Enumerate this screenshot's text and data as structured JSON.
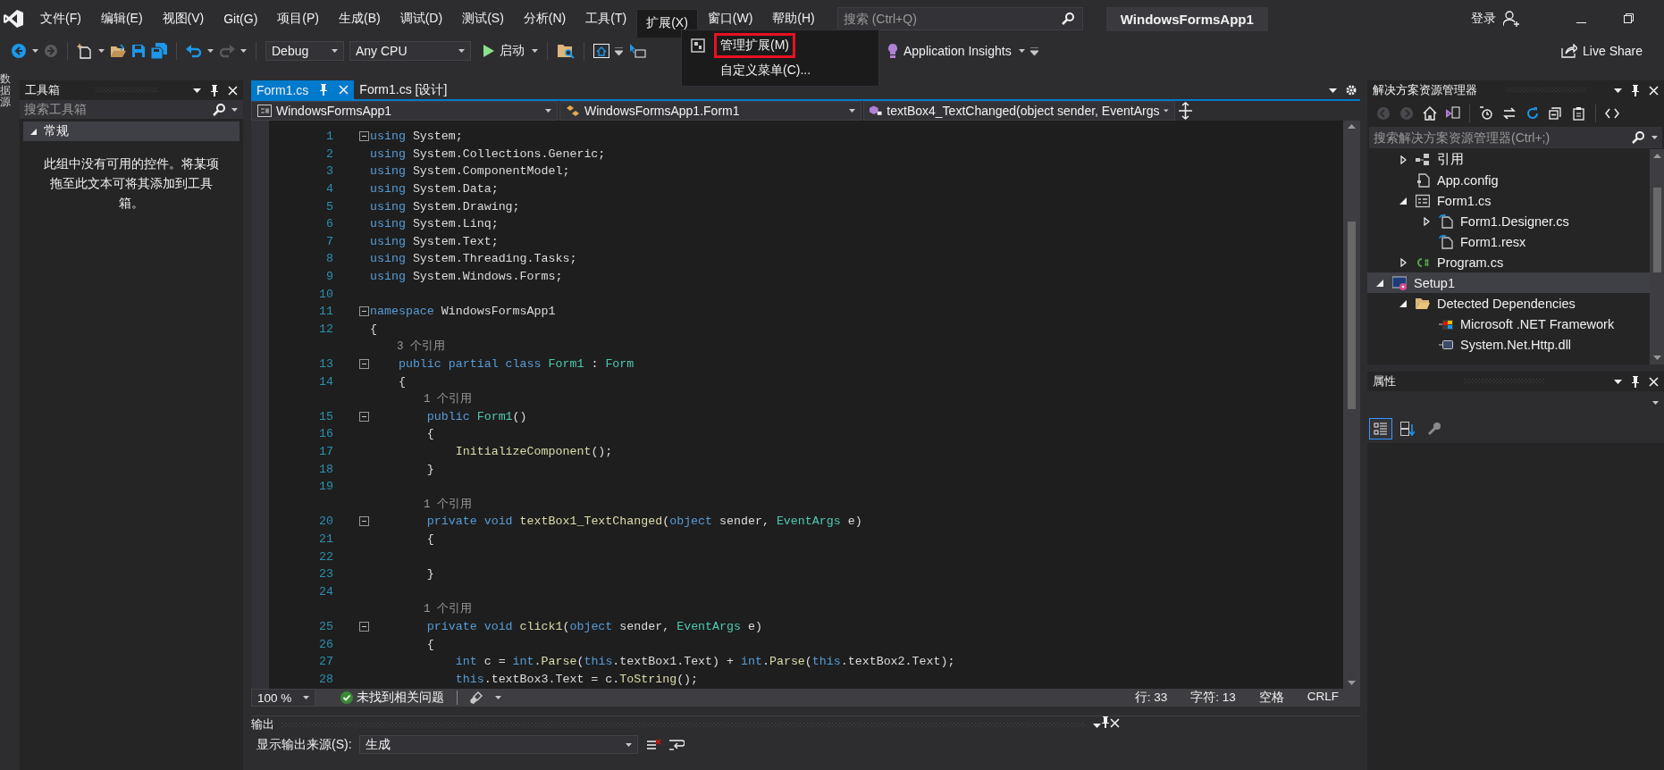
{
  "window": {
    "title": "WindowsFormsApp1",
    "side_tab": "数据源"
  },
  "menu": [
    {
      "label": "文件(F)",
      "selected": false
    },
    {
      "label": "编辑(E)",
      "selected": false
    },
    {
      "label": "视图(V)",
      "selected": false
    },
    {
      "label": "Git(G)",
      "selected": false
    },
    {
      "label": "项目(P)",
      "selected": false
    },
    {
      "label": "生成(B)",
      "selected": false
    },
    {
      "label": "调试(D)",
      "selected": false
    },
    {
      "label": "测试(S)",
      "selected": false
    },
    {
      "label": "分析(N)",
      "selected": false
    },
    {
      "label": "工具(T)",
      "selected": false
    },
    {
      "label": "扩展(X)",
      "selected": true
    },
    {
      "label": "窗口(W)",
      "selected": false
    },
    {
      "label": "帮助(H)",
      "selected": false
    }
  ],
  "dropdown": [
    {
      "label": "管理扩展(M)",
      "highlighted": true
    },
    {
      "label": "自定义菜单(C)...",
      "highlighted": false
    }
  ],
  "search": {
    "placeholder": "搜索 (Ctrl+Q)"
  },
  "account": {
    "label": "登录"
  },
  "toolbar": {
    "configuration": "Debug",
    "platform": "Any CPU",
    "start": "启动",
    "insights": "Application Insights",
    "live_share": "Live Share"
  },
  "toolbox": {
    "title": "工具箱",
    "search_placeholder": "搜索工具箱",
    "group": {
      "label": "常规",
      "expanded": true
    },
    "empty_message": "此组中没有可用的控件。将某项拖至此文本可将其添加到工具箱。"
  },
  "editor": {
    "tabs": [
      {
        "label": "Form1.cs",
        "selected": true
      },
      {
        "label": "Form1.cs [设计]",
        "selected": false
      }
    ],
    "navigation": [
      "WindowsFormsApp1",
      "WindowsFormsApp1.Form1",
      "textBox4_TextChanged(object sender, EventArgs"
    ],
    "lines": [
      {
        "kind": "code",
        "number": "1",
        "fold": true,
        "tokens": [
          {
            "text": "using",
            "kind": "kw"
          },
          {
            "text": " System;",
            "kind": "plain"
          }
        ]
      },
      {
        "kind": "code",
        "number": "2",
        "fold": false,
        "tokens": [
          {
            "text": "using",
            "kind": "kw"
          },
          {
            "text": " System.Collections.Generic;",
            "kind": "plain"
          }
        ]
      },
      {
        "kind": "code",
        "number": "3",
        "fold": false,
        "tokens": [
          {
            "text": "using",
            "kind": "kw"
          },
          {
            "text": " System.ComponentModel;",
            "kind": "plain"
          }
        ]
      },
      {
        "kind": "code",
        "number": "4",
        "fold": false,
        "tokens": [
          {
            "text": "using",
            "kind": "kw"
          },
          {
            "text": " System.Data;",
            "kind": "plain"
          }
        ]
      },
      {
        "kind": "code",
        "number": "5",
        "fold": false,
        "tokens": [
          {
            "text": "using",
            "kind": "kw"
          },
          {
            "text": " System.Drawing;",
            "kind": "plain"
          }
        ]
      },
      {
        "kind": "code",
        "number": "6",
        "fold": false,
        "tokens": [
          {
            "text": "using",
            "kind": "kw"
          },
          {
            "text": " System.Linq;",
            "kind": "plain"
          }
        ]
      },
      {
        "kind": "code",
        "number": "7",
        "fold": false,
        "tokens": [
          {
            "text": "using",
            "kind": "kw"
          },
          {
            "text": " System.Text;",
            "kind": "plain"
          }
        ]
      },
      {
        "kind": "code",
        "number": "8",
        "fold": false,
        "tokens": [
          {
            "text": "using",
            "kind": "kw"
          },
          {
            "text": " System.Threading.Tasks;",
            "kind": "plain"
          }
        ]
      },
      {
        "kind": "code",
        "number": "9",
        "fold": false,
        "tokens": [
          {
            "text": "using",
            "kind": "kw"
          },
          {
            "text": " System.Windows.Forms;",
            "kind": "plain"
          }
        ]
      },
      {
        "kind": "code",
        "number": "10",
        "fold": false
      },
      {
        "kind": "code",
        "number": "11",
        "fold": true,
        "tokens": [
          {
            "text": "namespace",
            "kind": "kw"
          },
          {
            "text": " WindowsFormsApp1",
            "kind": "plain"
          }
        ]
      },
      {
        "kind": "code",
        "number": "12",
        "fold": false,
        "tokens": [
          {
            "text": "{",
            "kind": "plain"
          }
        ]
      },
      {
        "kind": "reference",
        "text": "    3 个引用"
      },
      {
        "kind": "code",
        "number": "13",
        "fold": true,
        "tokens": [
          {
            "text": "    public",
            "kind": "kw"
          },
          {
            "text": " partial",
            "kind": "kw"
          },
          {
            "text": " class",
            "kind": "kw"
          },
          {
            "text": " Form1",
            "kind": "type"
          },
          {
            "text": " : ",
            "kind": "plain"
          },
          {
            "text": "Form",
            "kind": "type"
          }
        ]
      },
      {
        "kind": "code",
        "number": "14",
        "fold": false,
        "tokens": [
          {
            "text": "    {",
            "kind": "plain"
          }
        ]
      },
      {
        "kind": "reference",
        "text": "        1 个引用"
      },
      {
        "kind": "code",
        "number": "15",
        "fold": true,
        "tokens": [
          {
            "text": "        public",
            "kind": "kw"
          },
          {
            "text": " Form1",
            "kind": "type"
          },
          {
            "text": "()",
            "kind": "plain"
          }
        ]
      },
      {
        "kind": "code",
        "number": "16",
        "fold": false,
        "tokens": [
          {
            "text": "        {",
            "kind": "plain"
          }
        ]
      },
      {
        "kind": "code",
        "number": "17",
        "fold": false,
        "tokens": [
          {
            "text": "            InitializeComponent",
            "kind": "method"
          },
          {
            "text": "();",
            "kind": "plain"
          }
        ]
      },
      {
        "kind": "code",
        "number": "18",
        "fold": false,
        "tokens": [
          {
            "text": "        }",
            "kind": "plain"
          }
        ]
      },
      {
        "kind": "code",
        "number": "19",
        "fold": false
      },
      {
        "kind": "reference",
        "text": "        1 个引用"
      },
      {
        "kind": "code",
        "number": "20",
        "fold": true,
        "tokens": [
          {
            "text": "        private",
            "kind": "kw"
          },
          {
            "text": " void",
            "kind": "kw"
          },
          {
            "text": " textBox1_TextChanged",
            "kind": "method"
          },
          {
            "text": "(",
            "kind": "plain"
          },
          {
            "text": "object",
            "kind": "kw"
          },
          {
            "text": " sender, ",
            "kind": "plain"
          },
          {
            "text": "EventArgs",
            "kind": "type"
          },
          {
            "text": " e)",
            "kind": "plain"
          }
        ]
      },
      {
        "kind": "code",
        "number": "21",
        "fold": false,
        "tokens": [
          {
            "text": "        {",
            "kind": "plain"
          }
        ]
      },
      {
        "kind": "code",
        "number": "22",
        "fold": false
      },
      {
        "kind": "code",
        "number": "23",
        "fold": false,
        "tokens": [
          {
            "text": "        }",
            "kind": "plain"
          }
        ]
      },
      {
        "kind": "code",
        "number": "24",
        "fold": false
      },
      {
        "kind": "reference",
        "text": "        1 个引用"
      },
      {
        "kind": "code",
        "number": "25",
        "fold": true,
        "tokens": [
          {
            "text": "        private",
            "kind": "kw"
          },
          {
            "text": " void",
            "kind": "kw"
          },
          {
            "text": " click1",
            "kind": "method"
          },
          {
            "text": "(",
            "kind": "plain"
          },
          {
            "text": "object",
            "kind": "kw"
          },
          {
            "text": " sender, ",
            "kind": "plain"
          },
          {
            "text": "EventArgs",
            "kind": "type"
          },
          {
            "text": " e)",
            "kind": "plain"
          }
        ]
      },
      {
        "kind": "code",
        "number": "26",
        "fold": false,
        "tokens": [
          {
            "text": "        {",
            "kind": "plain"
          }
        ]
      },
      {
        "kind": "code",
        "number": "27",
        "fold": false,
        "tokens": [
          {
            "text": "            int",
            "kind": "kw"
          },
          {
            "text": " c = ",
            "kind": "plain"
          },
          {
            "text": "int",
            "kind": "kw"
          },
          {
            "text": ".",
            "kind": "plain"
          },
          {
            "text": "Parse",
            "kind": "method"
          },
          {
            "text": "(",
            "kind": "plain"
          },
          {
            "text": "this",
            "kind": "kw"
          },
          {
            "text": ".textBox1.Text) + ",
            "kind": "plain"
          },
          {
            "text": "int",
            "kind": "kw"
          },
          {
            "text": ".",
            "kind": "plain"
          },
          {
            "text": "Parse",
            "kind": "method"
          },
          {
            "text": "(",
            "kind": "plain"
          },
          {
            "text": "this",
            "kind": "kw"
          },
          {
            "text": ".textBox2.Text);",
            "kind": "plain"
          }
        ]
      },
      {
        "kind": "code",
        "number": "28",
        "fold": false,
        "tokens": [
          {
            "text": "            this",
            "kind": "kw"
          },
          {
            "text": ".textBox3.Text = c.",
            "kind": "plain"
          },
          {
            "text": "ToString",
            "kind": "method"
          },
          {
            "text": "();",
            "kind": "plain"
          }
        ]
      }
    ],
    "zoom": "100 %",
    "issues": "未找到相关问题",
    "line": "行: 33",
    "column": "字符: 13",
    "indent": "空格",
    "line_ending": "CRLF"
  },
  "output": {
    "title": "输出",
    "source_label": "显示输出来源(S):",
    "source": "生成"
  },
  "solution_explorer": {
    "title": "解决方案资源管理器",
    "search_placeholder": "搜索解决方案资源管理器(Ctrl+;)",
    "tree": [
      {
        "children": [
          {
            "label": "引用",
            "kind": "references",
            "expanded": false,
            "selected": false
          },
          {
            "label": "App.config",
            "kind": "config",
            "selected": false
          },
          {
            "label": "Form1.cs",
            "kind": "form",
            "expanded": true,
            "selected": false,
            "children": [
              {
                "label": "Form1.Designer.cs",
                "kind": "code-file",
                "expanded": false,
                "selected": false
              },
              {
                "label": "Form1.resx",
                "kind": "code-file",
                "selected": false
              }
            ]
          },
          {
            "label": "Program.cs",
            "kind": "csharp",
            "expanded": false,
            "selected": false
          }
        ]
      },
      {
        "label": "Setup1",
        "kind": "setup",
        "expanded": true,
        "selected": true,
        "children": [
          {
            "label": "Detected Dependencies",
            "kind": "folder",
            "expanded": true,
            "selected": false,
            "children": [
              {
                "label": "Microsoft .NET Framework",
                "kind": "dependency",
                "selected": false
              },
              {
                "label": "System.Net.Http.dll",
                "kind": "assembly",
                "selected": false
              }
            ]
          }
        ]
      }
    ]
  },
  "properties": {
    "title": "属性",
    "view_buttons": [
      {
        "kind": "categorized",
        "selected": true
      },
      {
        "kind": "alphabetical",
        "selected": false
      },
      {
        "kind": "property_pages",
        "selected": false
      }
    ]
  }
}
